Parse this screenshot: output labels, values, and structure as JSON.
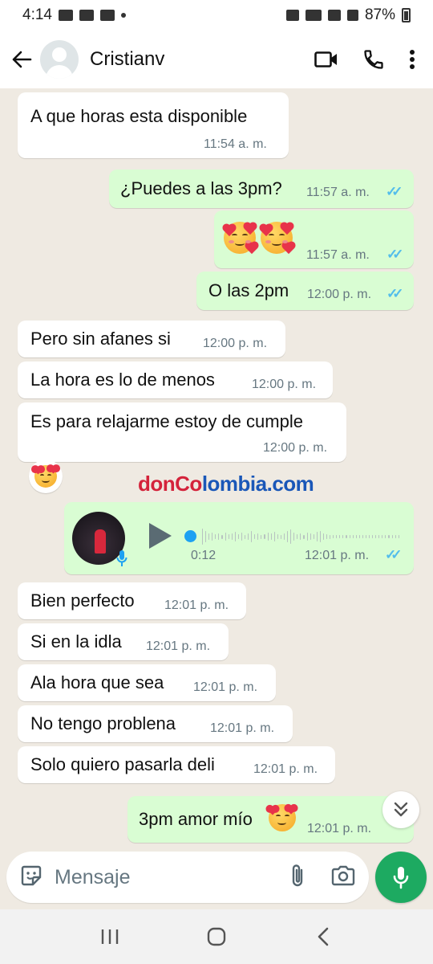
{
  "status_bar": {
    "time": "4:14",
    "battery": "87%"
  },
  "header": {
    "contact_name": "Cristianv"
  },
  "messages": [
    {
      "dir": "in",
      "text": "A que horas esta disponible",
      "time": "11:54 a. m."
    },
    {
      "dir": "out",
      "text": "¿Puedes a las 3pm?",
      "time": "11:57 a. m."
    },
    {
      "dir": "out",
      "text": "",
      "emoji": "smiling-face-with-hearts x2",
      "time": "11:57 a. m."
    },
    {
      "dir": "out",
      "text": "O las 2pm",
      "time": "12:00 p. m."
    },
    {
      "dir": "in",
      "text": "Pero sin afanes si",
      "time": "12:00 p. m."
    },
    {
      "dir": "in",
      "text": "La hora es lo de menos",
      "time": "12:00 p. m."
    },
    {
      "dir": "in",
      "text": "Es para relajarme estoy de cumple",
      "time": "12:00 p. m."
    },
    {
      "dir": "out",
      "type": "voice",
      "duration": "0:12",
      "time": "12:01 p. m."
    },
    {
      "dir": "in",
      "text": "Bien perfecto",
      "time": "12:01 p. m."
    },
    {
      "dir": "in",
      "text": "Si en la idla",
      "time": "12:01 p. m."
    },
    {
      "dir": "in",
      "text": "Ala hora que sea",
      "time": "12:01 p. m."
    },
    {
      "dir": "in",
      "text": "No tengo problena",
      "time": "12:01 p. m."
    },
    {
      "dir": "in",
      "text": "Solo quiero pasarla deli",
      "time": "12:01 p. m."
    },
    {
      "dir": "out",
      "text": "3pm amor mío",
      "time": "12:01 p. m."
    }
  ],
  "reaction": "smiling-face-with-hearts",
  "watermark": {
    "part1": "donCo",
    "part2": "lombia.com"
  },
  "input": {
    "placeholder": "Mensaje"
  },
  "colors": {
    "chat_bg": "#efeae2",
    "outgoing_bubble": "#d9fdd3",
    "incoming_bubble": "#ffffff",
    "read_ticks": "#53bdeb",
    "send_button": "#1daa61"
  },
  "icons": {
    "header": [
      "back-arrow-icon",
      "video-call-icon",
      "phone-icon",
      "more-vert-icon"
    ],
    "input": [
      "sticker-icon",
      "attach-icon",
      "camera-icon",
      "microphone-icon"
    ],
    "nav": [
      "recents-icon",
      "home-icon",
      "back-icon"
    ]
  }
}
